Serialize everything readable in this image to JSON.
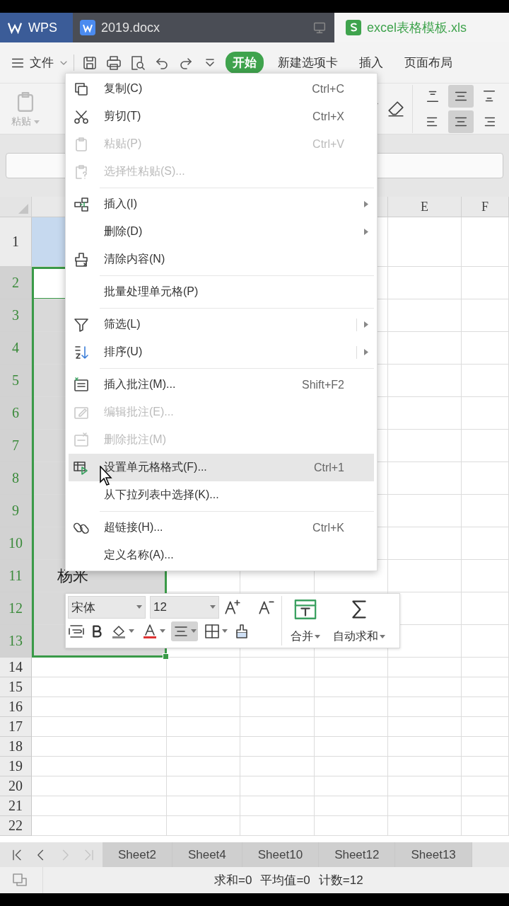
{
  "tabs": [
    {
      "kind": "home",
      "label": "WPS",
      "selected": false
    },
    {
      "kind": "doc",
      "label": "2019.docx",
      "selected": false
    },
    {
      "kind": "sheet",
      "label": "excel表格模板.xls",
      "selected": true
    }
  ],
  "toolbar": {
    "file_menu": "文件",
    "ribbon_tabs": [
      {
        "label": "开始",
        "selected": true
      },
      {
        "label": "新建选项卡",
        "selected": false
      },
      {
        "label": "插入",
        "selected": false
      },
      {
        "label": "页面布局",
        "selected": false
      }
    ]
  },
  "ribbon": {
    "paste_label": "粘贴",
    "align_buttons": [
      {
        "selected": false
      },
      {
        "selected": true
      },
      {
        "selected": false
      },
      {
        "selected": false
      },
      {
        "selected": true
      },
      {
        "selected": false
      }
    ]
  },
  "columns": [
    "E",
    "F"
  ],
  "rows": [
    {
      "number": "1",
      "selected": false,
      "active": false,
      "color": "#c6d9ef"
    },
    {
      "number": "2",
      "selected": true,
      "active": true
    },
    {
      "number": "3",
      "selected": true,
      "active": false
    },
    {
      "number": "4",
      "selected": true,
      "active": false
    },
    {
      "number": "5",
      "selected": true,
      "active": false
    },
    {
      "number": "6",
      "selected": true,
      "active": false
    },
    {
      "number": "7",
      "selected": true,
      "active": false
    },
    {
      "number": "8",
      "selected": true,
      "active": false
    },
    {
      "number": "9",
      "selected": true,
      "active": false
    },
    {
      "number": "10",
      "selected": true,
      "active": false
    },
    {
      "number": "11",
      "selected": true,
      "active": false,
      "cell_a": "杨米"
    },
    {
      "number": "12",
      "selected": true,
      "active": false
    },
    {
      "number": "13",
      "selected": true,
      "active": false
    },
    {
      "number": "14",
      "selected": false,
      "active": false
    },
    {
      "number": "15",
      "selected": false,
      "active": false
    },
    {
      "number": "16",
      "selected": false,
      "active": false
    },
    {
      "number": "17",
      "selected": false,
      "active": false
    },
    {
      "number": "18",
      "selected": false,
      "active": false
    },
    {
      "number": "19",
      "selected": false,
      "active": false
    },
    {
      "number": "20",
      "selected": false,
      "active": false
    },
    {
      "number": "21",
      "selected": false,
      "active": false
    },
    {
      "number": "22",
      "selected": false,
      "active": false
    }
  ],
  "context_menu": [
    {
      "kind": "item",
      "label": "复制(C)",
      "shortcut": "Ctrl+C",
      "disabled": false,
      "submenu": false,
      "highlighted": false
    },
    {
      "kind": "item",
      "label": "剪切(T)",
      "shortcut": "Ctrl+X",
      "disabled": false,
      "submenu": false,
      "highlighted": false
    },
    {
      "kind": "item",
      "label": "粘贴(P)",
      "shortcut": "Ctrl+V",
      "disabled": true,
      "submenu": false,
      "highlighted": false
    },
    {
      "kind": "item",
      "label": "选择性粘贴(S)...",
      "disabled": true,
      "submenu": false,
      "highlighted": false
    },
    {
      "kind": "separator"
    },
    {
      "kind": "item",
      "label": "插入(I)",
      "disabled": false,
      "submenu": true,
      "highlighted": false
    },
    {
      "kind": "item",
      "label": "删除(D)",
      "disabled": false,
      "submenu": true,
      "highlighted": false
    },
    {
      "kind": "item",
      "label": "清除内容(N)",
      "disabled": false,
      "submenu": false,
      "highlighted": false
    },
    {
      "kind": "separator"
    },
    {
      "kind": "item",
      "label": "批量处理单元格(P)",
      "disabled": false,
      "submenu": false,
      "highlighted": false
    },
    {
      "kind": "separator"
    },
    {
      "kind": "item",
      "label": "筛选(L)",
      "disabled": false,
      "submenu": true,
      "highlighted": false
    },
    {
      "kind": "item",
      "label": "排序(U)",
      "disabled": false,
      "submenu": true,
      "highlighted": false
    },
    {
      "kind": "separator"
    },
    {
      "kind": "item",
      "label": "插入批注(M)...",
      "shortcut": "Shift+F2",
      "disabled": false,
      "submenu": false,
      "highlighted": false
    },
    {
      "kind": "item",
      "label": "编辑批注(E)...",
      "disabled": true,
      "submenu": false,
      "highlighted": false
    },
    {
      "kind": "item",
      "label": "删除批注(M)",
      "disabled": true,
      "submenu": false,
      "highlighted": false
    },
    {
      "kind": "item",
      "label": "设置单元格格式(F)...",
      "shortcut": "Ctrl+1",
      "disabled": false,
      "submenu": false,
      "highlighted": true
    },
    {
      "kind": "item",
      "label": "从下拉列表中选择(K)...",
      "disabled": false,
      "submenu": false,
      "highlighted": false
    },
    {
      "kind": "separator"
    },
    {
      "kind": "item",
      "label": "超链接(H)...",
      "shortcut": "Ctrl+K",
      "disabled": false,
      "submenu": false,
      "highlighted": false
    },
    {
      "kind": "item",
      "label": "定义名称(A)...",
      "disabled": false,
      "submenu": false,
      "highlighted": false
    }
  ],
  "mini_toolbar": {
    "font": "宋体",
    "size": "12",
    "align_selected": true,
    "merge_label": "合并",
    "autosum_label": "自动求和"
  },
  "sheet_nav": [
    {
      "disabled": false
    },
    {
      "disabled": false
    },
    {
      "disabled": true
    },
    {
      "disabled": true
    }
  ],
  "sheet_tabs": [
    {
      "label": "Sheet2",
      "selected": false
    },
    {
      "label": "Sheet4",
      "selected": false
    },
    {
      "label": "Sheet10",
      "selected": false
    },
    {
      "label": "Sheet12",
      "selected": false
    },
    {
      "label": "Sheet13",
      "selected": false
    }
  ],
  "status_bar": [
    "求和=0",
    "平均值=0",
    "计数=12"
  ]
}
